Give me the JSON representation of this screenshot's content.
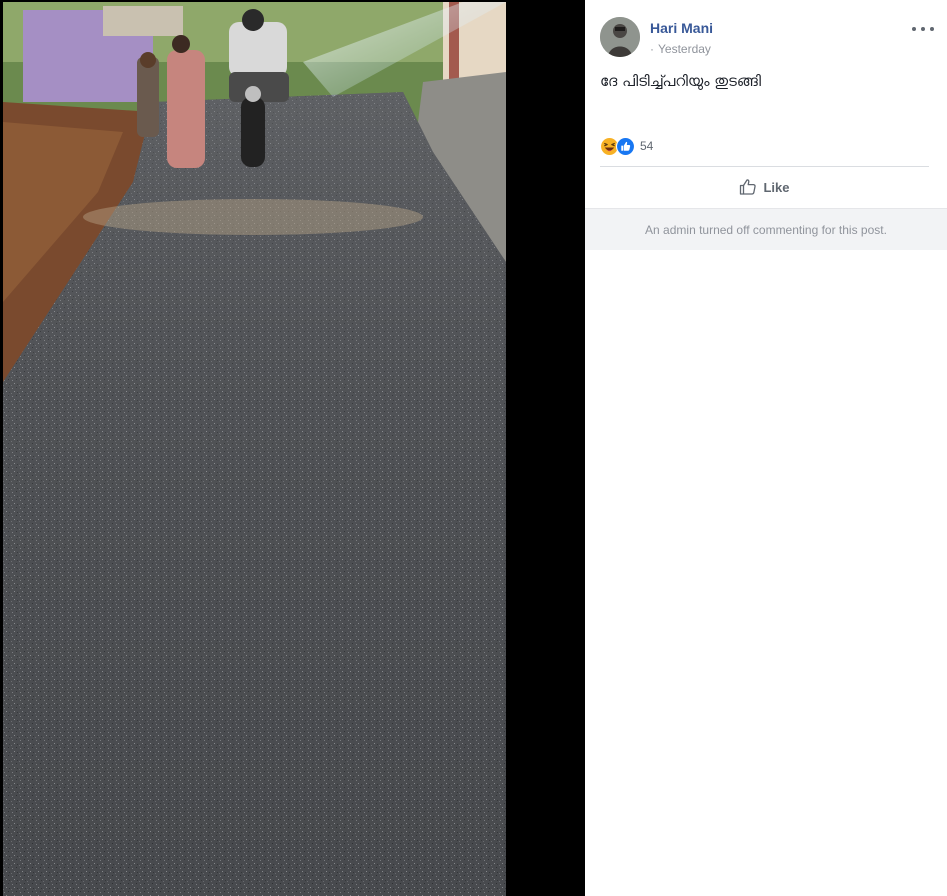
{
  "photo": {
    "alt_icon": "road-photo"
  },
  "post": {
    "author": "Hari Mani",
    "meta_separator": "·",
    "timestamp": "Yesterday",
    "text": "ദേ പിടിച്ച്പറിയും തുടങ്ങി",
    "reactions": {
      "icons": [
        "haha-icon",
        "like-reaction-icon"
      ],
      "count": "54"
    },
    "actions": {
      "like_label": "Like"
    },
    "comments_notice": "An admin turned off commenting for this post."
  },
  "colors": {
    "name_link": "#385898",
    "meta_text": "#90949c",
    "like_blue": "#1877f2",
    "haha_yellow": "#f7b125"
  }
}
